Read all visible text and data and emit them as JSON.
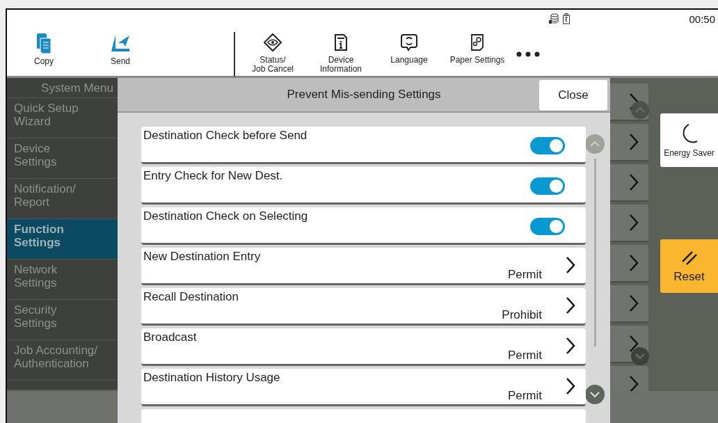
{
  "status_bar": {
    "time": "00:50"
  },
  "toolbar": {
    "functions": [
      {
        "kind": "copy",
        "label": "Copy"
      },
      {
        "kind": "send",
        "label": "Send"
      }
    ],
    "tools": [
      {
        "kind": "status",
        "label": "Status/\nJob Cancel"
      },
      {
        "kind": "info",
        "label": "Device\nInformation"
      },
      {
        "kind": "language",
        "label": "Language"
      },
      {
        "kind": "paper",
        "label": "Paper Settings"
      }
    ]
  },
  "sidebar": {
    "title": "System Menu",
    "items": [
      {
        "label": "Quick Setup\nWizard",
        "selected": false
      },
      {
        "label": "Device\nSettings",
        "selected": false
      },
      {
        "label": "Notification/\nReport",
        "selected": false
      },
      {
        "label": "Function\nSettings",
        "selected": true
      },
      {
        "label": "Network\nSettings",
        "selected": false
      },
      {
        "label": "Security\nSettings",
        "selected": false
      },
      {
        "label": "Job Accounting/\nAuthentication",
        "selected": false
      }
    ]
  },
  "right_panel": {
    "energy_saver": "Energy Saver",
    "reset": "Reset"
  },
  "dialog": {
    "title": "Prevent Mis-sending Settings",
    "close": "Close",
    "rows": [
      {
        "kind": "toggle",
        "label": "Destination Check before Send",
        "on": true
      },
      {
        "kind": "toggle",
        "label": "Entry Check for New Dest.",
        "on": true
      },
      {
        "kind": "toggle",
        "label": "Destination Check on Selecting",
        "on": true
      },
      {
        "kind": "value",
        "label": "New Destination Entry",
        "value": "Permit"
      },
      {
        "kind": "value",
        "label": "Recall Destination",
        "value": "Prohibit"
      },
      {
        "kind": "value",
        "label": "Broadcast",
        "value": "Permit"
      },
      {
        "kind": "value",
        "label": "Destination History Usage",
        "value": "Permit"
      }
    ]
  }
}
